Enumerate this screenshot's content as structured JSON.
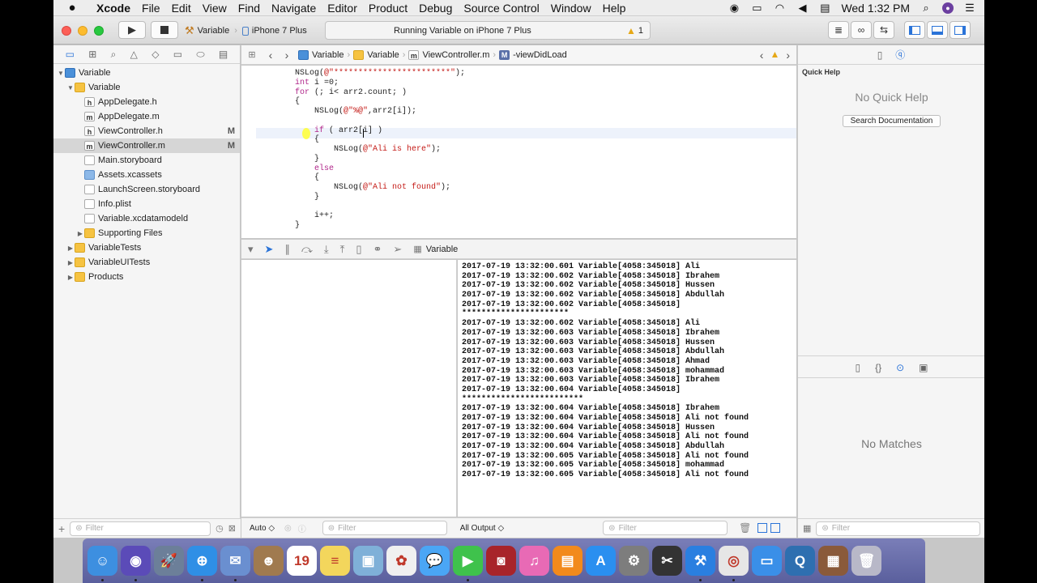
{
  "menubar": {
    "app_name": "Xcode",
    "items": [
      "File",
      "Edit",
      "View",
      "Find",
      "Navigate",
      "Editor",
      "Product",
      "Debug",
      "Source Control",
      "Window",
      "Help"
    ],
    "clock": "Wed 1:32 PM"
  },
  "toolbar": {
    "scheme_name": "Variable",
    "device": "iPhone 7 Plus",
    "status_text": "Running Variable on iPhone 7 Plus",
    "warning_count": "1"
  },
  "navigator": {
    "rows": [
      {
        "label": "Variable",
        "indent": 0,
        "icon": "project",
        "disclosure": "open"
      },
      {
        "label": "Variable",
        "indent": 1,
        "icon": "folder",
        "disclosure": "open"
      },
      {
        "label": "AppDelegate.h",
        "indent": 2,
        "icon": "file-h"
      },
      {
        "label": "AppDelegate.m",
        "indent": 2,
        "icon": "file-m"
      },
      {
        "label": "ViewController.h",
        "indent": 2,
        "icon": "file-h",
        "badge": "M"
      },
      {
        "label": "ViewController.m",
        "indent": 2,
        "icon": "file-m",
        "badge": "M",
        "selected": true
      },
      {
        "label": "Main.storyboard",
        "indent": 2,
        "icon": "storyboard"
      },
      {
        "label": "Assets.xcassets",
        "indent": 2,
        "icon": "assets"
      },
      {
        "label": "LaunchScreen.storyboard",
        "indent": 2,
        "icon": "storyboard"
      },
      {
        "label": "Info.plist",
        "indent": 2,
        "icon": "plist"
      },
      {
        "label": "Variable.xcdatamodeld",
        "indent": 2,
        "icon": "datamodel"
      },
      {
        "label": "Supporting Files",
        "indent": 2,
        "icon": "folder",
        "disclosure": "closed"
      },
      {
        "label": "VariableTests",
        "indent": 1,
        "icon": "folder",
        "disclosure": "closed"
      },
      {
        "label": "VariableUITests",
        "indent": 1,
        "icon": "folder",
        "disclosure": "closed"
      },
      {
        "label": "Products",
        "indent": 1,
        "icon": "folder",
        "disclosure": "closed"
      }
    ],
    "filter_placeholder": "Filter"
  },
  "jumpbar": {
    "crumbs": [
      "Variable",
      "Variable",
      "ViewController.m",
      "-viewDidLoad"
    ]
  },
  "code": {
    "lines": [
      [
        {
          "t": "        NSLog(",
          "c": ""
        },
        {
          "t": "@\"************************\"",
          "c": "str"
        },
        {
          "t": ");",
          "c": ""
        }
      ],
      [
        {
          "t": "        ",
          "c": ""
        },
        {
          "t": "int",
          "c": "kw"
        },
        {
          "t": " i =0;",
          "c": ""
        }
      ],
      [
        {
          "t": "        ",
          "c": ""
        },
        {
          "t": "for",
          "c": "kw"
        },
        {
          "t": " (; i< arr2.count; )",
          "c": ""
        }
      ],
      [
        {
          "t": "        {",
          "c": ""
        }
      ],
      [
        {
          "t": "            NSLog(",
          "c": ""
        },
        {
          "t": "@\"%@\"",
          "c": "str"
        },
        {
          "t": ",arr2[i]);",
          "c": ""
        }
      ],
      [
        {
          "t": "",
          "c": ""
        }
      ],
      [
        {
          "t": "            ",
          "c": ""
        },
        {
          "t": "if",
          "c": "kw"
        },
        {
          "t": " ( arr2[i] )",
          "c": ""
        }
      ],
      [
        {
          "t": "            {",
          "c": ""
        }
      ],
      [
        {
          "t": "                NSLog(",
          "c": ""
        },
        {
          "t": "@\"Ali is here\"",
          "c": "str"
        },
        {
          "t": ");",
          "c": ""
        }
      ],
      [
        {
          "t": "            }",
          "c": ""
        }
      ],
      [
        {
          "t": "            ",
          "c": ""
        },
        {
          "t": "else",
          "c": "kw"
        }
      ],
      [
        {
          "t": "            {",
          "c": ""
        }
      ],
      [
        {
          "t": "                NSLog(",
          "c": ""
        },
        {
          "t": "@\"Ali not found\"",
          "c": "str"
        },
        {
          "t": ");",
          "c": ""
        }
      ],
      [
        {
          "t": "            }",
          "c": ""
        }
      ],
      [
        {
          "t": "",
          "c": ""
        }
      ],
      [
        {
          "t": "            i++;",
          "c": ""
        }
      ],
      [
        {
          "t": "        }",
          "c": ""
        }
      ]
    ]
  },
  "debugbar": {
    "process_name": "Variable"
  },
  "console": {
    "lines": [
      "2017-07-19 13:32:00.601 Variable[4058:345018] Ali",
      "2017-07-19 13:32:00.602 Variable[4058:345018] Ibrahem",
      "2017-07-19 13:32:00.602 Variable[4058:345018] Hussen",
      "2017-07-19 13:32:00.602 Variable[4058:345018] Abdullah",
      "2017-07-19 13:32:00.602 Variable[4058:345018]",
      "**********************",
      "2017-07-19 13:32:00.602 Variable[4058:345018] Ali",
      "2017-07-19 13:32:00.603 Variable[4058:345018] Ibrahem",
      "2017-07-19 13:32:00.603 Variable[4058:345018] Hussen",
      "2017-07-19 13:32:00.603 Variable[4058:345018] Abdullah",
      "2017-07-19 13:32:00.603 Variable[4058:345018] Ahmad",
      "2017-07-19 13:32:00.603 Variable[4058:345018] mohammad",
      "2017-07-19 13:32:00.603 Variable[4058:345018] Ibrahem",
      "2017-07-19 13:32:00.604 Variable[4058:345018]",
      "*************************",
      "2017-07-19 13:32:00.604 Variable[4058:345018] Ibrahem",
      "2017-07-19 13:32:00.604 Variable[4058:345018] Ali not found",
      "2017-07-19 13:32:00.604 Variable[4058:345018] Hussen",
      "2017-07-19 13:32:00.604 Variable[4058:345018] Ali not found",
      "2017-07-19 13:32:00.604 Variable[4058:345018] Abdullah",
      "2017-07-19 13:32:00.605 Variable[4058:345018] Ali not found",
      "2017-07-19 13:32:00.605 Variable[4058:345018] mohammad",
      "2017-07-19 13:32:00.605 Variable[4058:345018] Ali not found"
    ]
  },
  "debugfoot": {
    "auto_label": "Auto ◇",
    "filter_placeholder": "Filter",
    "output_label": "All Output ◇",
    "output_filter_placeholder": "Filter"
  },
  "inspector": {
    "quick_help_title": "Quick Help",
    "no_quick_help": "No Quick Help",
    "search_docs_button": "Search Documentation",
    "no_matches": "No Matches",
    "filter_placeholder": "Filter"
  },
  "dock": {
    "apps": [
      {
        "name": "Finder",
        "glyph": "☺",
        "color": "#3d8fe0"
      },
      {
        "name": "Siri",
        "glyph": "◉",
        "color": "#5b4bb8"
      },
      {
        "name": "Launchpad",
        "glyph": "🚀",
        "color": "#6c7f99"
      },
      {
        "name": "Safari",
        "glyph": "⊕",
        "color": "#2f8fe6"
      },
      {
        "name": "Mail",
        "glyph": "✉",
        "color": "#6a8fd0"
      },
      {
        "name": "Contacts",
        "glyph": "☻",
        "color": "#a07a4f"
      },
      {
        "name": "Calendar",
        "glyph": "19",
        "color": "#ffffff"
      },
      {
        "name": "Notes",
        "glyph": "≡",
        "color": "#f3d65c"
      },
      {
        "name": "Preview",
        "glyph": "▣",
        "color": "#7fb0d8"
      },
      {
        "name": "Photos",
        "glyph": "✿",
        "color": "#f0f0f0"
      },
      {
        "name": "Messages",
        "glyph": "💬",
        "color": "#4aa6f5"
      },
      {
        "name": "FaceTime",
        "glyph": "▶",
        "color": "#3fc24c"
      },
      {
        "name": "Photo Booth",
        "glyph": "◙",
        "color": "#a8242a"
      },
      {
        "name": "iTunes",
        "glyph": "♫",
        "color": "#e86ab5"
      },
      {
        "name": "iBooks",
        "glyph": "▤",
        "color": "#f28a1c"
      },
      {
        "name": "App Store",
        "glyph": "A",
        "color": "#2a8ff0"
      },
      {
        "name": "System Preferences",
        "glyph": "⚙",
        "color": "#7d7d7d"
      },
      {
        "name": "Final Cut Pro",
        "glyph": "✂",
        "color": "#333333"
      },
      {
        "name": "Xcode",
        "glyph": "⚒",
        "color": "#2a7fe0"
      },
      {
        "name": "Chrome",
        "glyph": "◎",
        "color": "#e6e6e6"
      },
      {
        "name": "Simulator",
        "glyph": "▭",
        "color": "#3a8fe8"
      },
      {
        "name": "QuickTime",
        "glyph": "Q",
        "color": "#2e6fb0"
      },
      {
        "name": "Downloads",
        "glyph": "▦",
        "color": "#8a5a3a"
      },
      {
        "name": "Trash",
        "glyph": "🗑",
        "color": "#b8b8c8"
      }
    ]
  }
}
